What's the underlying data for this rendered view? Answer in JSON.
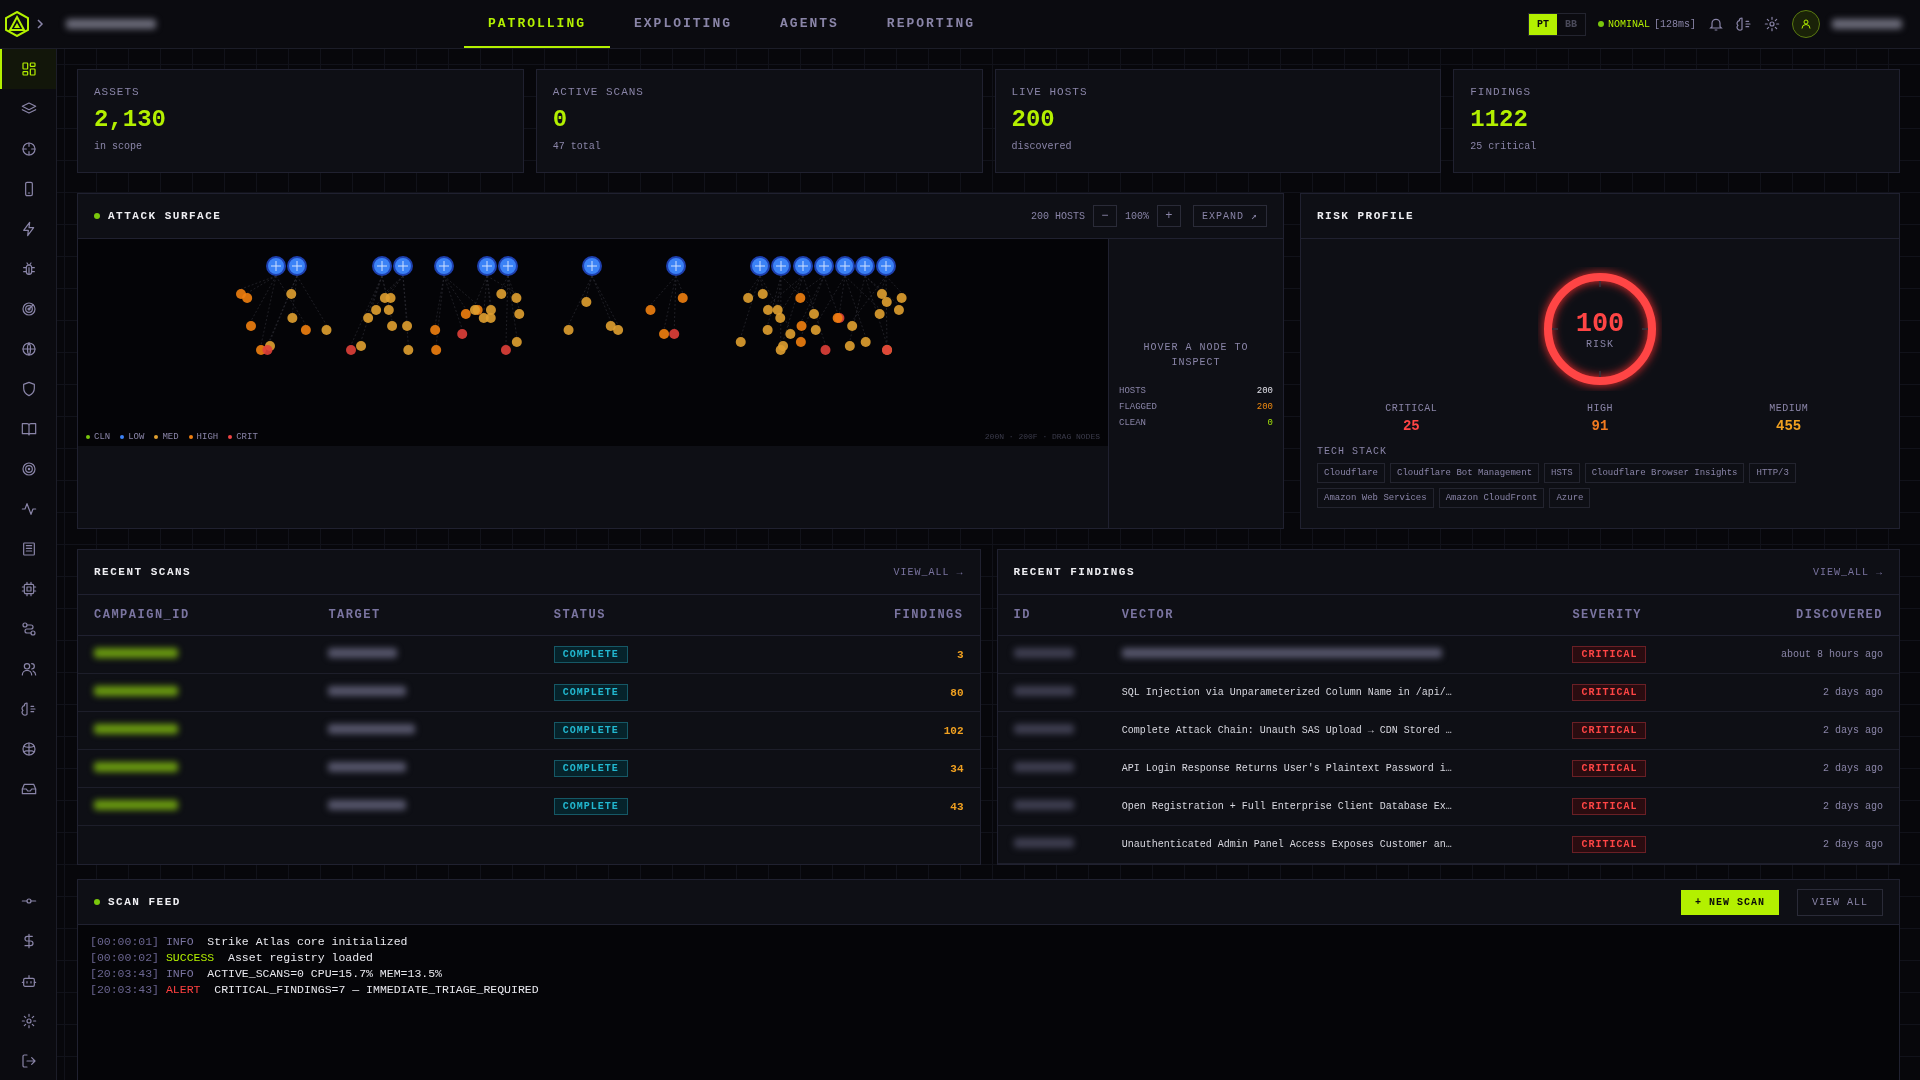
{
  "nav_tabs": [
    {
      "label": "PATROLLING",
      "selected": true
    },
    {
      "label": "EXPLOITING",
      "selected": false
    },
    {
      "label": "AGENTS",
      "selected": false
    },
    {
      "label": "REPORTING",
      "selected": false
    }
  ],
  "mode_toggle": [
    {
      "label": "PT",
      "selected": true
    },
    {
      "label": "BB",
      "selected": false
    }
  ],
  "status": {
    "label": "NOMINAL",
    "latency": "[128ms]"
  },
  "sidebar": {
    "items": [
      {
        "selected": true
      },
      {
        "selected": false
      },
      {
        "selected": false
      },
      {
        "selected": false
      },
      {
        "selected": false
      },
      {
        "selected": false
      },
      {
        "selected": false
      },
      {
        "selected": false
      },
      {
        "selected": false
      },
      {
        "selected": false
      },
      {
        "selected": false
      },
      {
        "selected": false
      },
      {
        "selected": false
      },
      {
        "selected": false
      },
      {
        "selected": false
      },
      {
        "selected": false
      },
      {
        "selected": false
      },
      {
        "selected": false
      },
      {
        "selected": false
      }
    ],
    "bottom_items": [
      {
        "selected": false
      },
      {
        "selected": false
      },
      {
        "selected": false
      },
      {
        "selected": false
      },
      {
        "selected": false
      }
    ]
  },
  "stats": [
    {
      "label": "ASSETS",
      "value": "2,130",
      "caption": "in scope"
    },
    {
      "label": "ACTIVE SCANS",
      "value": "0",
      "caption": "47 total"
    },
    {
      "label": "LIVE HOSTS",
      "value": "200",
      "caption": "discovered"
    },
    {
      "label": "FINDINGS",
      "value": "1122",
      "caption": "25 critical"
    }
  ],
  "attack_surface": {
    "title": "ATTACK SURFACE",
    "host_count": "200 HOSTS",
    "zoom_out": "−",
    "zoom": "100%",
    "zoom_in": "+",
    "expand": "EXPAND ↗",
    "legend": [
      {
        "label": "CLN",
        "color": "#7ac70c"
      },
      {
        "label": "LOW",
        "color": "#3b82f6"
      },
      {
        "label": "MED",
        "color": "#e0a030"
      },
      {
        "label": "HIGH",
        "color": "#f08010"
      },
      {
        "label": "CRIT",
        "color": "#ef4444"
      }
    ],
    "graph_hint": "200N · 200F · DRAG NODES",
    "inspector": {
      "prompt": "HOVER A NODE TO INSPECT",
      "stats": [
        {
          "label": "HOSTS",
          "value": "200",
          "kind": "neutral"
        },
        {
          "label": "FLAGGED",
          "value": "200",
          "kind": "warn"
        },
        {
          "label": "CLEAN",
          "value": "0",
          "kind": "ok"
        }
      ]
    }
  },
  "risk_profile": {
    "title": "RISK PROFILE",
    "score": "100",
    "score_label": "RISK",
    "level": 1,
    "severities": [
      {
        "label": "CRITICAL",
        "value": "25",
        "kind": "critical"
      },
      {
        "label": "HIGH",
        "value": "91",
        "kind": "high"
      },
      {
        "label": "MEDIUM",
        "value": "455",
        "kind": "medium"
      }
    ],
    "tech_stack_title": "TECH STACK",
    "tech_stack": [
      "Cloudflare",
      "Cloudflare Bot Management",
      "HSTS",
      "Cloudflare Browser Insights",
      "HTTP/3",
      "Amazon Web Services",
      "Amazon CloudFront",
      "Azure"
    ]
  },
  "recent_scans": {
    "title": "RECENT SCANS",
    "view_all": "VIEW_ALL →",
    "columns": [
      "CAMPAIGN_ID",
      "TARGET",
      "STATUS",
      "FINDINGS"
    ],
    "rows": [
      {
        "status": "COMPLETE",
        "findings": "3"
      },
      {
        "status": "COMPLETE",
        "findings": "80"
      },
      {
        "status": "COMPLETE",
        "findings": "102"
      },
      {
        "status": "COMPLETE",
        "findings": "34"
      },
      {
        "status": "COMPLETE",
        "findings": "43"
      }
    ]
  },
  "recent_findings": {
    "title": "RECENT FINDINGS",
    "view_all": "VIEW_ALL →",
    "columns": [
      "ID",
      "VECTOR",
      "SEVERITY",
      "DISCOVERED"
    ],
    "rows": [
      {
        "severity": "CRITICAL",
        "discovered": "about 8 hours ago"
      },
      {
        "vector": "SQL Injection via Unparameterized Column Name in /api/…",
        "severity": "CRITICAL",
        "discovered": "2 days ago"
      },
      {
        "vector": "Complete Attack Chain: Unauth SAS Upload → CDN Stored …",
        "severity": "CRITICAL",
        "discovered": "2 days ago"
      },
      {
        "vector": "API Login Response Returns User's Plaintext Password i…",
        "severity": "CRITICAL",
        "discovered": "2 days ago"
      },
      {
        "vector": "Open Registration + Full Enterprise Client Database Ex…",
        "severity": "CRITICAL",
        "discovered": "2 days ago"
      },
      {
        "vector": "Unauthenticated Admin Panel Access Exposes Customer an…",
        "severity": "CRITICAL",
        "discovered": "2 days ago"
      }
    ]
  },
  "scan_feed": {
    "title": "SCAN FEED",
    "new_scan": "+ NEW SCAN",
    "view_all": "VIEW ALL",
    "lines": [
      {
        "time": "[00:00:01]",
        "level": "INFO",
        "kind": "info",
        "message": "Strike Atlas core initialized"
      },
      {
        "time": "[00:00:02]",
        "level": "SUCCESS",
        "kind": "success",
        "message": "Asset registry loaded"
      },
      {
        "time": "[20:03:43]",
        "level": "INFO",
        "kind": "info",
        "message": "ACTIVE_SCANS=0 CPU=15.7% MEM=13.5%"
      },
      {
        "time": "[20:03:43]",
        "level": "ALERT",
        "kind": "alert",
        "message": "CRITICAL_FINDINGS=7 — IMMEDIATE_TRIAGE_REQUIRED"
      }
    ]
  }
}
